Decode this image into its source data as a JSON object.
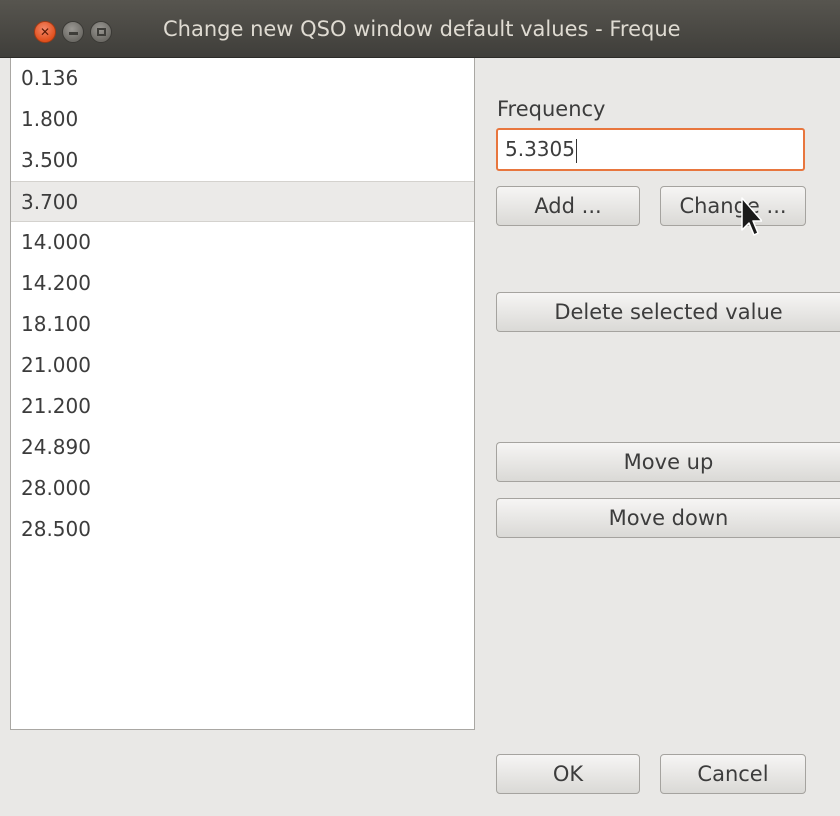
{
  "window": {
    "title": "Change new QSO window default values - Freque"
  },
  "list": {
    "items": [
      "0.136",
      "1.800",
      "3.500",
      "3.700",
      "14.000",
      "14.200",
      "18.100",
      "21.000",
      "21.200",
      "24.890",
      "28.000",
      "28.500"
    ],
    "selected_index": 3
  },
  "frequency": {
    "label": "Frequency",
    "value": "5.3305"
  },
  "buttons": {
    "add": "Add ...",
    "change": "Change ...",
    "delete": "Delete selected value",
    "move_up": "Move up",
    "move_down": "Move down",
    "ok": "OK",
    "cancel": "Cancel"
  },
  "colors": {
    "close_button": "#e1501d",
    "input_focus_border": "#e8763e",
    "titlebar": "#3f3e3a",
    "selected_row": "#ebeae8"
  },
  "icons": {
    "close": "close-icon",
    "minimize": "minimize-icon",
    "maximize": "maximize-icon",
    "cursor": "mouse-pointer-icon"
  }
}
